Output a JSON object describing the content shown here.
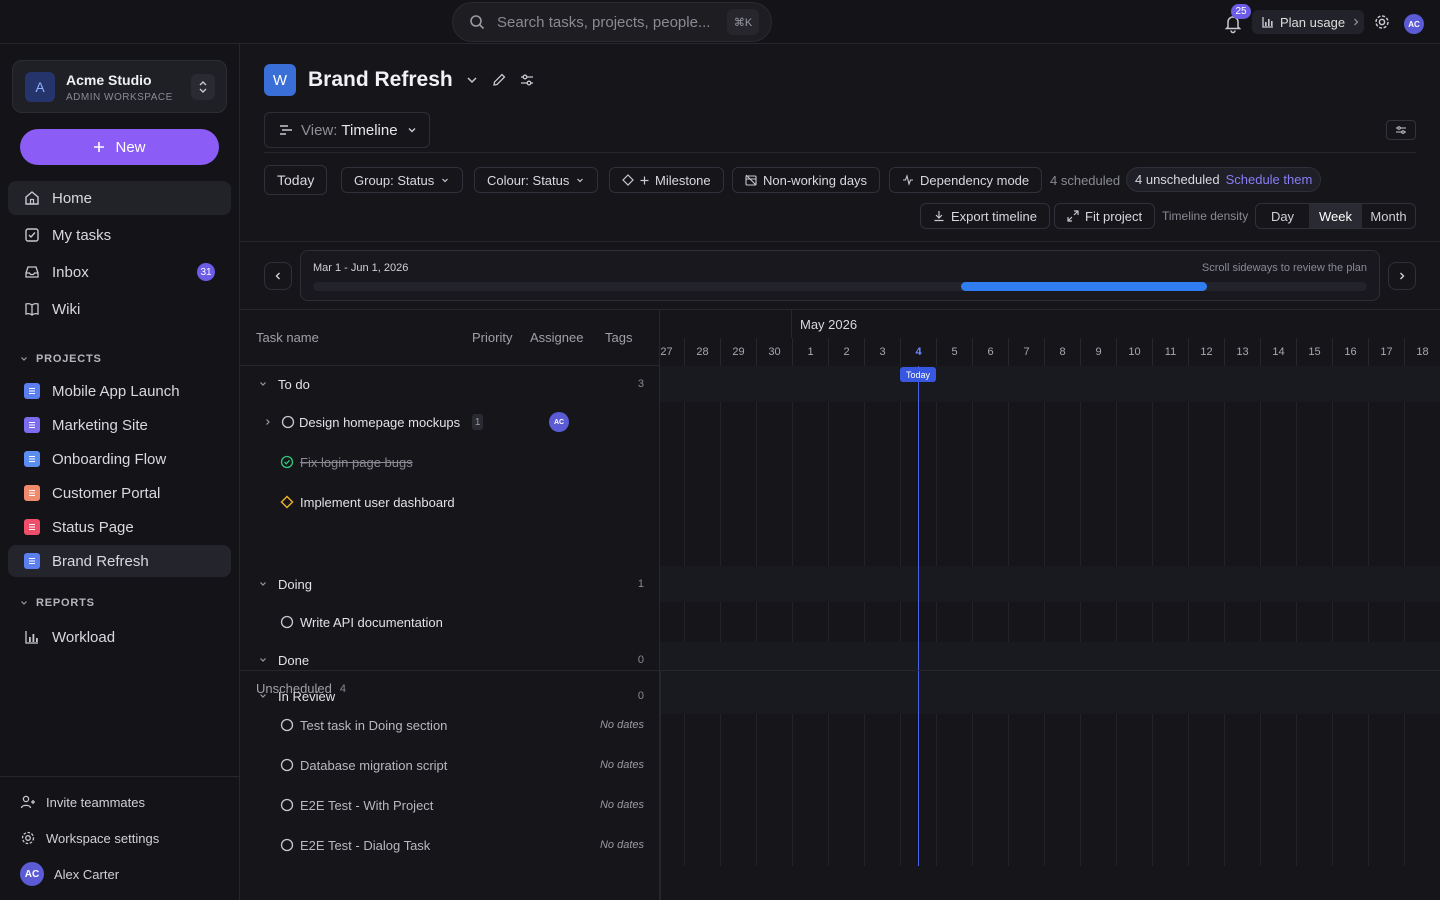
{
  "topbar": {
    "search_placeholder": "Search tasks, projects, people...",
    "shortcut": "⌘K",
    "notif_count": "25",
    "plan_usage": "Plan usage",
    "avatar": "AC"
  },
  "sidebar": {
    "workspace_initial": "A",
    "workspace_name": "Acme Studio",
    "workspace_role": "ADMIN WORKSPACE",
    "new_label": "New",
    "nav": [
      {
        "label": "Home"
      },
      {
        "label": "My tasks"
      },
      {
        "label": "Inbox",
        "badge": "31"
      },
      {
        "label": "Wiki"
      }
    ],
    "projects_header": "PROJECTS",
    "projects": [
      {
        "label": "Mobile App Launch",
        "color": "#5b7ff0"
      },
      {
        "label": "Marketing Site",
        "color": "#7c6cf0"
      },
      {
        "label": "Onboarding Flow",
        "color": "#5b8ef0"
      },
      {
        "label": "Customer Portal",
        "color": "#f08a6c"
      },
      {
        "label": "Status Page",
        "color": "#f04f6c"
      },
      {
        "label": "Brand Refresh",
        "color": "#5b7ff0"
      }
    ],
    "reports_header": "REPORTS",
    "reports": [
      {
        "label": "Workload"
      }
    ],
    "invite": "Invite teammates",
    "ws_settings": "Workspace settings",
    "user_initials": "AC",
    "user_name": "Alex Carter"
  },
  "project": {
    "initial": "W",
    "title": "Brand Refresh",
    "view_key": "View:",
    "view_value": "Timeline"
  },
  "toolbar": {
    "today": "Today",
    "group": "Group: Status",
    "colour": "Colour: Status",
    "milestone": "Milestone",
    "nonworking": "Non-working days",
    "dependency": "Dependency mode",
    "scheduled": "4 scheduled",
    "unscheduled": "4 unscheduled",
    "schedule_link": "Schedule them",
    "export": "Export timeline",
    "fit": "Fit project",
    "density_label": "Timeline density",
    "density_options": [
      "Day",
      "Week",
      "Month"
    ],
    "density_selected": "Week"
  },
  "range": {
    "label": "Mar 1 - Jun 1, 2026",
    "hint": "Scroll sideways to review the plan",
    "scroll_start": 0.615,
    "scroll_end": 0.848
  },
  "table": {
    "headers": [
      "Task name",
      "Priority",
      "Assignee",
      "Tags"
    ],
    "groups": [
      {
        "name": "To do",
        "count": "3"
      },
      {
        "name": "Doing",
        "count": "1"
      },
      {
        "name": "Done",
        "count": "0"
      },
      {
        "name": "In Review",
        "count": "0"
      }
    ],
    "tasks": [
      {
        "name": "Design homepage mockups",
        "subtasks": "1",
        "assignee": "AC"
      },
      {
        "name": "Fix login page bugs"
      },
      {
        "name": "Implement user dashboard"
      },
      {
        "name": "Write API documentation"
      }
    ],
    "unscheduled_label": "Unscheduled",
    "unscheduled_count": "4",
    "unscheduled_tasks": [
      {
        "name": "Test task in Doing section",
        "dates": "No dates"
      },
      {
        "name": "Database migration script",
        "dates": "No dates"
      },
      {
        "name": "E2E Test - With Project",
        "dates": "No dates"
      },
      {
        "name": "E2E Test - Dialog Task",
        "dates": "No dates"
      }
    ]
  },
  "timeline": {
    "month": "May 2026",
    "days": [
      "27",
      "28",
      "29",
      "30",
      "1",
      "2",
      "3",
      "4",
      "5",
      "6",
      "7",
      "8",
      "9",
      "10",
      "11",
      "12",
      "13",
      "14",
      "15",
      "16",
      "17",
      "18"
    ],
    "today_day": "4",
    "today_label": "Today"
  }
}
